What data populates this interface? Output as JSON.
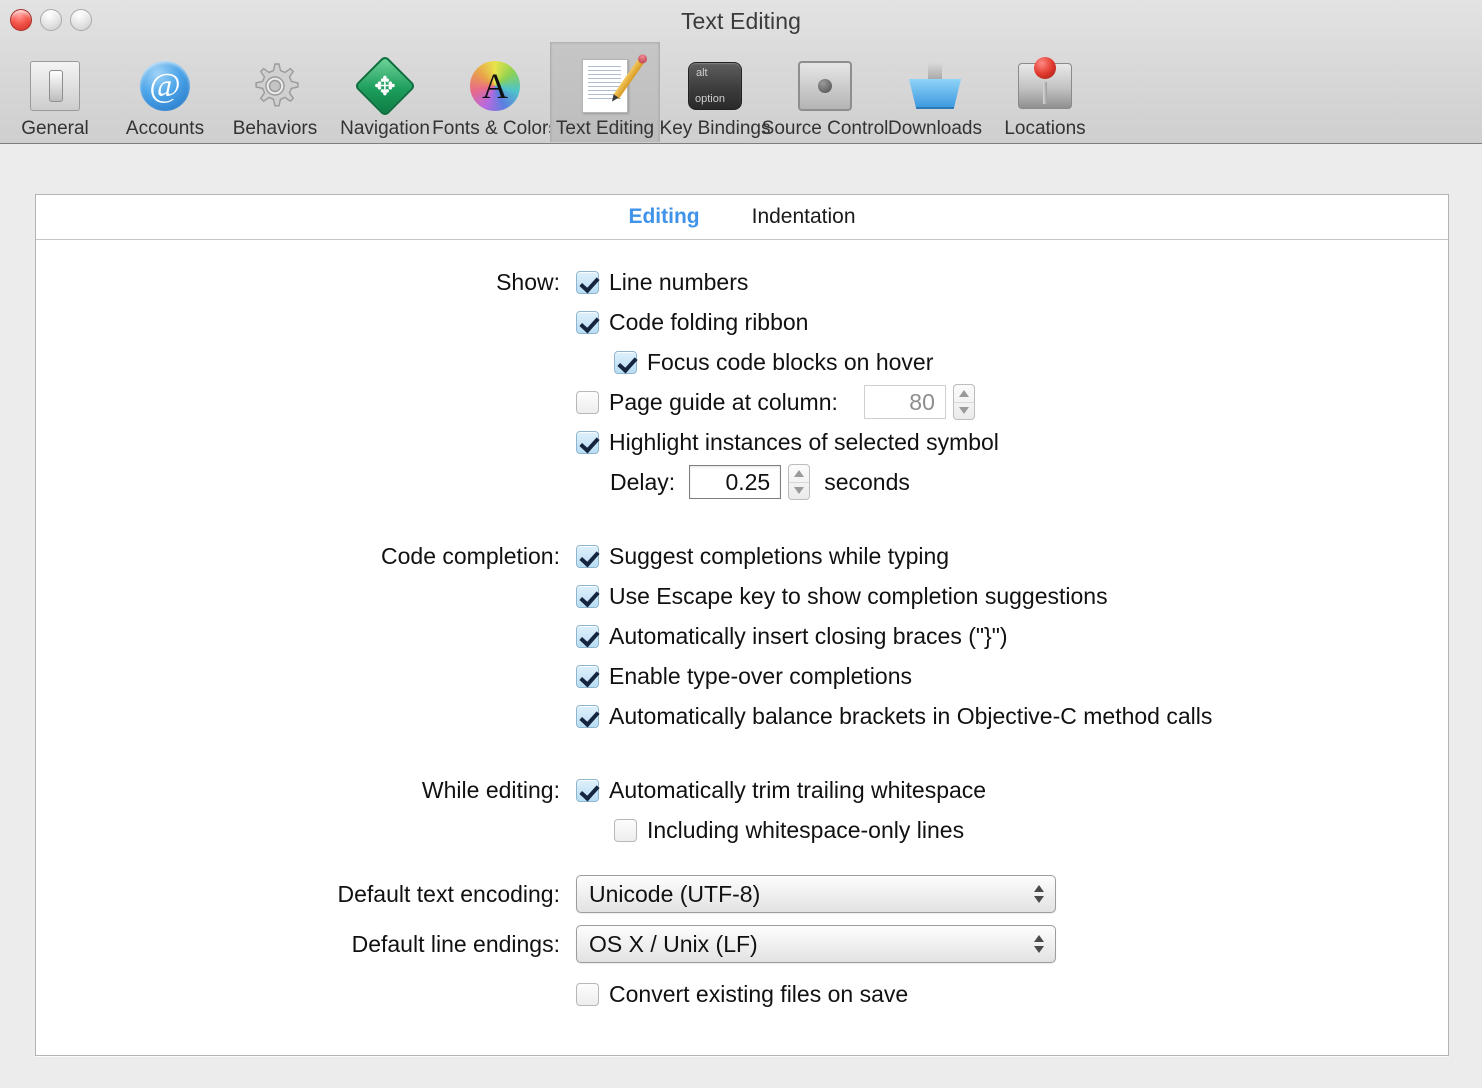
{
  "window": {
    "title": "Text Editing",
    "controls": [
      {
        "name": "close",
        "label": "Close"
      },
      {
        "name": "minimize",
        "label": "Minimize"
      },
      {
        "name": "zoom",
        "label": "Zoom"
      }
    ]
  },
  "toolbar": {
    "items": [
      {
        "id": "general",
        "label": "General",
        "icon": "toggle-switch-icon",
        "selected": false
      },
      {
        "id": "accounts",
        "label": "Accounts",
        "icon": "at-sign-icon",
        "selected": false
      },
      {
        "id": "behaviors",
        "label": "Behaviors",
        "icon": "gear-icon",
        "selected": false
      },
      {
        "id": "navigation",
        "label": "Navigation",
        "icon": "move-arrows-icon",
        "selected": false
      },
      {
        "id": "fonts-colors",
        "label": "Fonts & Colors",
        "icon": "color-wheel-a-icon",
        "selected": false
      },
      {
        "id": "text-editing",
        "label": "Text Editing",
        "icon": "document-pencil-icon",
        "selected": true
      },
      {
        "id": "key-bindings",
        "label": "Key Bindings",
        "icon": "option-key-icon",
        "selected": false
      },
      {
        "id": "source-control",
        "label": "Source Control",
        "icon": "safe-icon",
        "selected": false
      },
      {
        "id": "downloads",
        "label": "Downloads",
        "icon": "download-tray-icon",
        "selected": false
      },
      {
        "id": "locations",
        "label": "Locations",
        "icon": "hard-drive-icon",
        "selected": false
      }
    ],
    "key_icon": {
      "top": "alt",
      "bottom": "option"
    },
    "accounts_glyph": "@",
    "fonts_glyph": "A",
    "navigation_glyph": "✥"
  },
  "tabs": [
    {
      "id": "editing",
      "label": "Editing",
      "active": true
    },
    {
      "id": "indentation",
      "label": "Indentation",
      "active": false
    }
  ],
  "sections": {
    "show": {
      "label": "Show:",
      "line_numbers": {
        "label": "Line numbers",
        "checked": true
      },
      "code_folding_ribbon": {
        "label": "Code folding ribbon",
        "checked": true
      },
      "focus_code_blocks": {
        "label": "Focus code blocks on hover",
        "checked": true
      },
      "page_guide": {
        "label": "Page guide at column:",
        "checked": false,
        "value": "80",
        "enabled": false
      },
      "highlight_instances": {
        "label": "Highlight instances of selected symbol",
        "checked": true
      },
      "delay": {
        "label": "Delay:",
        "value": "0.25",
        "suffix": "seconds",
        "enabled": true
      }
    },
    "code_completion": {
      "label": "Code completion:",
      "items": [
        {
          "label": "Suggest completions while typing",
          "checked": true
        },
        {
          "label": "Use Escape key to show completion suggestions",
          "checked": true
        },
        {
          "label": "Automatically insert closing braces (\"}\")",
          "checked": true
        },
        {
          "label": "Enable type-over completions",
          "checked": true
        },
        {
          "label": "Automatically balance brackets in Objective-C method calls",
          "checked": true
        }
      ]
    },
    "while_editing": {
      "label": "While editing:",
      "trim_whitespace": {
        "label": "Automatically trim trailing whitespace",
        "checked": true
      },
      "including_whitespace_only": {
        "label": "Including whitespace-only lines",
        "checked": false
      }
    },
    "encoding": {
      "label": "Default text encoding:",
      "value": "Unicode (UTF-8)"
    },
    "line_endings": {
      "label": "Default line endings:",
      "value": "OS X / Unix (LF)"
    },
    "convert_on_save": {
      "label": "Convert existing files on save",
      "checked": false
    }
  },
  "colors": {
    "accent": "#3f93e8",
    "window_bg": "#ececec",
    "panel_bg": "#ffffff",
    "checkbox_on": "#b8ddf4",
    "text": "#111111",
    "disabled_text": "#8d8d8d"
  }
}
